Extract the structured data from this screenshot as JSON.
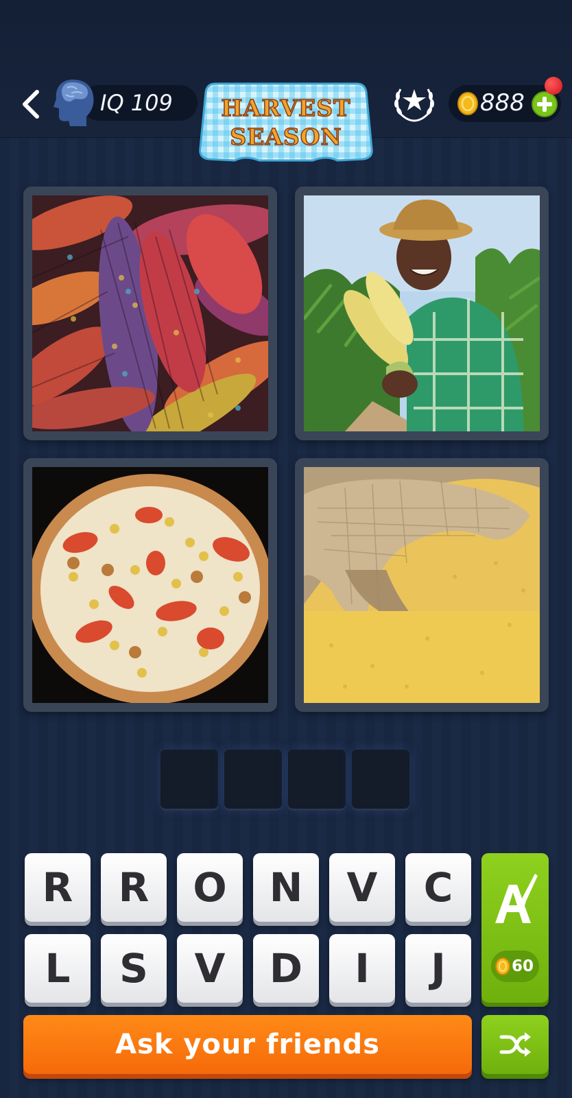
{
  "header": {
    "iq_text": "IQ 109",
    "banner_line1": "HARVEST",
    "banner_line2": "SEASON",
    "coins": "888"
  },
  "icons": {
    "back": "back-chevron-icon",
    "iq": "brain-head-icon",
    "laurel": "laurel-star-icon",
    "coin": "coin-icon",
    "plus": "plus-icon",
    "hint": "letter-a-brush-icon",
    "shuffle": "shuffle-icon"
  },
  "puzzle": {
    "images": [
      {
        "subject": "colorful-corn-cobs"
      },
      {
        "subject": "farmer-holding-corn"
      },
      {
        "subject": "corn-pizza"
      },
      {
        "subject": "cornmeal-sack"
      }
    ],
    "answer_slots": [
      "",
      "",
      "",
      ""
    ]
  },
  "keyboard": {
    "row1": [
      "R",
      "R",
      "O",
      "N",
      "V",
      "C"
    ],
    "row2": [
      "L",
      "S",
      "V",
      "D",
      "I",
      "J"
    ]
  },
  "hint": {
    "price": "60"
  },
  "actions": {
    "ask_label": "Ask your friends"
  },
  "colors": {
    "background": "#182640",
    "ask_button": "#f57a10",
    "hint_button": "#7fc014",
    "banner_text": "#f2a42b"
  }
}
